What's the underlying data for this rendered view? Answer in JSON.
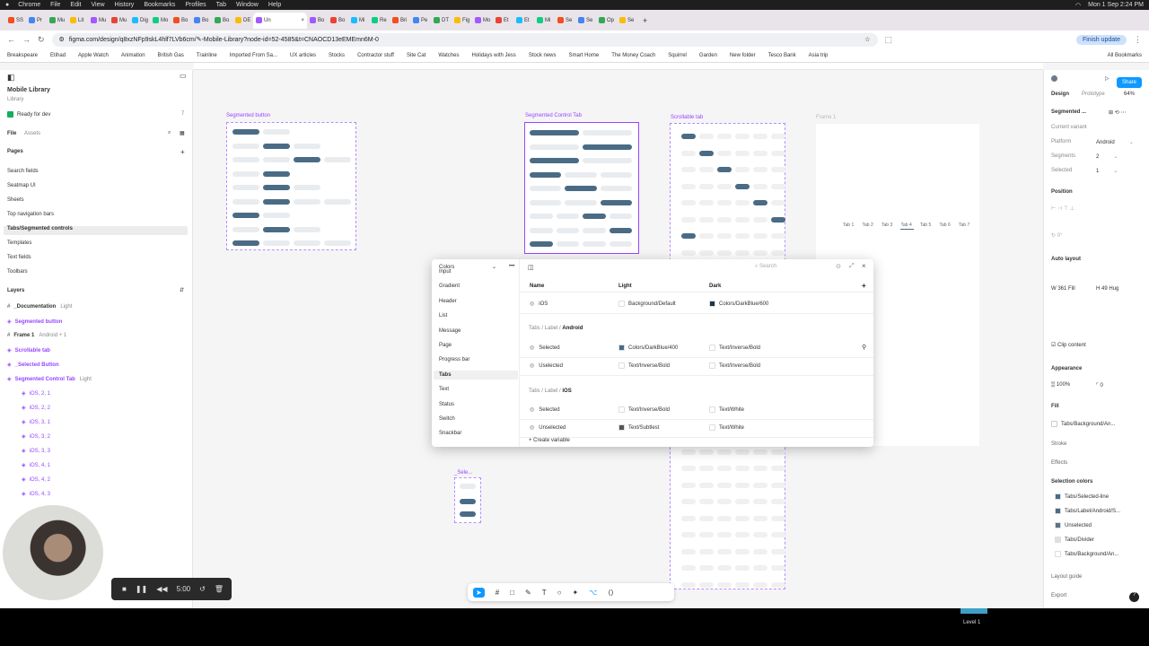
{
  "menubar": {
    "items": [
      "Chrome",
      "File",
      "Edit",
      "View",
      "History",
      "Bookmarks",
      "Profiles",
      "Tab",
      "Window",
      "Help"
    ],
    "clock": "Mon 1 Sep 2:24 PM"
  },
  "tabs": {
    "active_label": "Un",
    "other_labels": [
      "SS",
      "Pr",
      "Mu",
      "Lit",
      "Mu",
      "Mu",
      "Dig",
      "Mo",
      "Bo",
      "Bo",
      "Bo",
      "DE",
      "Bo",
      "Bo",
      "Mi",
      "Re",
      "Bri",
      "Pe",
      "DT",
      "Fig",
      "Mo",
      "Et",
      "Et",
      "Mi",
      "Se",
      "Se",
      "Op",
      "Se"
    ]
  },
  "browser": {
    "url": "figma.com/design/q8xzNFp9skL4hlf7LVb6cm/✎-Mobile-Library?node-id=52-4585&t=CNAOCD13eEMEmn6M-0",
    "finish_update": "Finish update"
  },
  "bookmarks": [
    "Breakspeare",
    "Etihad",
    "Apple Watch",
    "Animation",
    "British Gas",
    "Trainline",
    "Imported From Sa...",
    "UX articles",
    "Stocks",
    "Contractor stuff",
    "Site Cat",
    "Watches",
    "Holidays with Jess",
    "Stock news",
    "Smart Home",
    "The Money Coach",
    "Squirrel",
    "Garden",
    "New folder",
    "Tesco Bank",
    "Asia trip"
  ],
  "bookmarks_all": "All Bookmarks",
  "left_panel": {
    "file_title": "Mobile Library",
    "file_subtitle": "Library",
    "ready_for_dev": "Ready for dev",
    "ready_count": "7",
    "tab_file": "File",
    "tab_assets": "Assets",
    "pages_header": "Pages",
    "pages": [
      "Search fields",
      "Seatmap UI",
      "Sheets",
      "Top navigation bars",
      "Tabs/Segmented controls",
      "Templates",
      "Text fields",
      "Toolbars"
    ],
    "layers_header": "Layers",
    "layers": [
      {
        "name": "_Documentation",
        "tag": "Light",
        "purple": false
      },
      {
        "name": "Segmented button",
        "tag": "",
        "purple": true
      },
      {
        "name": "Frame 1",
        "tag": "Android + 1",
        "purple": false
      },
      {
        "name": "Scrollable tab",
        "tag": "",
        "purple": true
      },
      {
        "name": "_Selected Button",
        "tag": "",
        "purple": true
      },
      {
        "name": "Segmented Control Tab",
        "tag": "Light",
        "purple": true
      },
      {
        "name": "iOS, 2, 1",
        "tag": "",
        "purple": true
      },
      {
        "name": "iOS, 2, 2",
        "tag": "",
        "purple": true
      },
      {
        "name": "iOS, 3, 1",
        "tag": "",
        "purple": true
      },
      {
        "name": "iOS, 3, 2",
        "tag": "",
        "purple": true
      },
      {
        "name": "iOS, 3, 3",
        "tag": "",
        "purple": true
      },
      {
        "name": "iOS, 4, 1",
        "tag": "",
        "purple": true
      },
      {
        "name": "iOS, 4, 2",
        "tag": "",
        "purple": true
      },
      {
        "name": "iOS, 4, 3",
        "tag": "",
        "purple": true
      }
    ]
  },
  "canvas": {
    "frames": [
      "Segmented button",
      "Segmented Control Tab",
      "Scrollable tab",
      "Frame 1",
      "_Sele..."
    ],
    "scroll_tabs": [
      "Tab 1",
      "Tab 2",
      "Tab 3",
      "Tab 4",
      "Tab 5",
      "Tab 6",
      "Tab 7"
    ]
  },
  "variables_modal": {
    "collection": "Colors",
    "search_placeholder": "Search",
    "groups": [
      "Input",
      "Gradient",
      "Header",
      "List",
      "Message",
      "Page",
      "Progress bar",
      "Tabs",
      "Text",
      "Status",
      "Switch",
      "Snackbar"
    ],
    "active_group": "Tabs",
    "col_name": "Name",
    "col_light": "Light",
    "col_dark": "Dark",
    "rows": [
      {
        "name": "iOS",
        "light": "Background/Default",
        "dark": "Colors/DarkBlue/600",
        "light_color": "#ffffff",
        "dark_color": "#1f3647"
      }
    ],
    "group_android_prefix": "Tabs / Label /",
    "group_android": "Android",
    "android_rows": [
      {
        "name": "Selected",
        "light": "Colors/DarkBlue/400",
        "dark": "Text/Inverse/Bold",
        "light_color": "#4a6b85",
        "dark_color": "#ffffff"
      },
      {
        "name": "Uselected",
        "light": "Text/Inverse/Bold",
        "dark": "Text/Inverse/Bold",
        "light_color": "#ffffff",
        "dark_color": "#ffffff"
      }
    ],
    "group_ios_prefix": "Tabs / Label /",
    "group_ios": "iOS",
    "ios_rows": [
      {
        "name": "Selected",
        "light": "Text/Inverse/Bold",
        "dark": "Text/White",
        "light_color": "#ffffff",
        "dark_color": "#ffffff"
      },
      {
        "name": "Unselected",
        "light": "Text/Subtlest",
        "dark": "Text/White",
        "light_color": "#555555",
        "dark_color": "#ffffff"
      }
    ],
    "create_variable": "Create variable"
  },
  "right_panel": {
    "share": "Share",
    "tab_design": "Design",
    "tab_prototype": "Prototype",
    "zoom": "64%",
    "component_name": "Segmented ...",
    "current_variant": "Current variant",
    "props": [
      {
        "label": "Platform",
        "value": "Android"
      },
      {
        "label": "Segments",
        "value": "2"
      },
      {
        "label": "Selected",
        "value": "1"
      }
    ],
    "position": "Position",
    "auto_layout": "Auto layout",
    "w_value": "361",
    "w_mode": "Fill",
    "h_value": "49",
    "h_mode": "Hug",
    "clip_content": "Clip content",
    "appearance": "Appearance",
    "opacity": "100%",
    "radius": "0",
    "fill": "Fill",
    "fill_value": "Tabs/Background/An...",
    "stroke": "Stroke",
    "effects": "Effects",
    "selection_colors": "Selection colors",
    "selection_color_items": [
      {
        "name": "Tabs/Selected-line",
        "color": "#4a6b85"
      },
      {
        "name": "Tabs/Label/Android/S...",
        "color": "#4a6b85"
      },
      {
        "name": "Unselected",
        "color": "#5c7385"
      },
      {
        "name": "Tabs/Divider",
        "color": "#e0e0e0"
      },
      {
        "name": "Tabs/Background/An...",
        "color": "#ffffff"
      }
    ],
    "layout_guide": "Layout guide",
    "export": "Export"
  },
  "recorder": {
    "time": "5:00"
  },
  "status": {
    "level": "Level 1"
  }
}
